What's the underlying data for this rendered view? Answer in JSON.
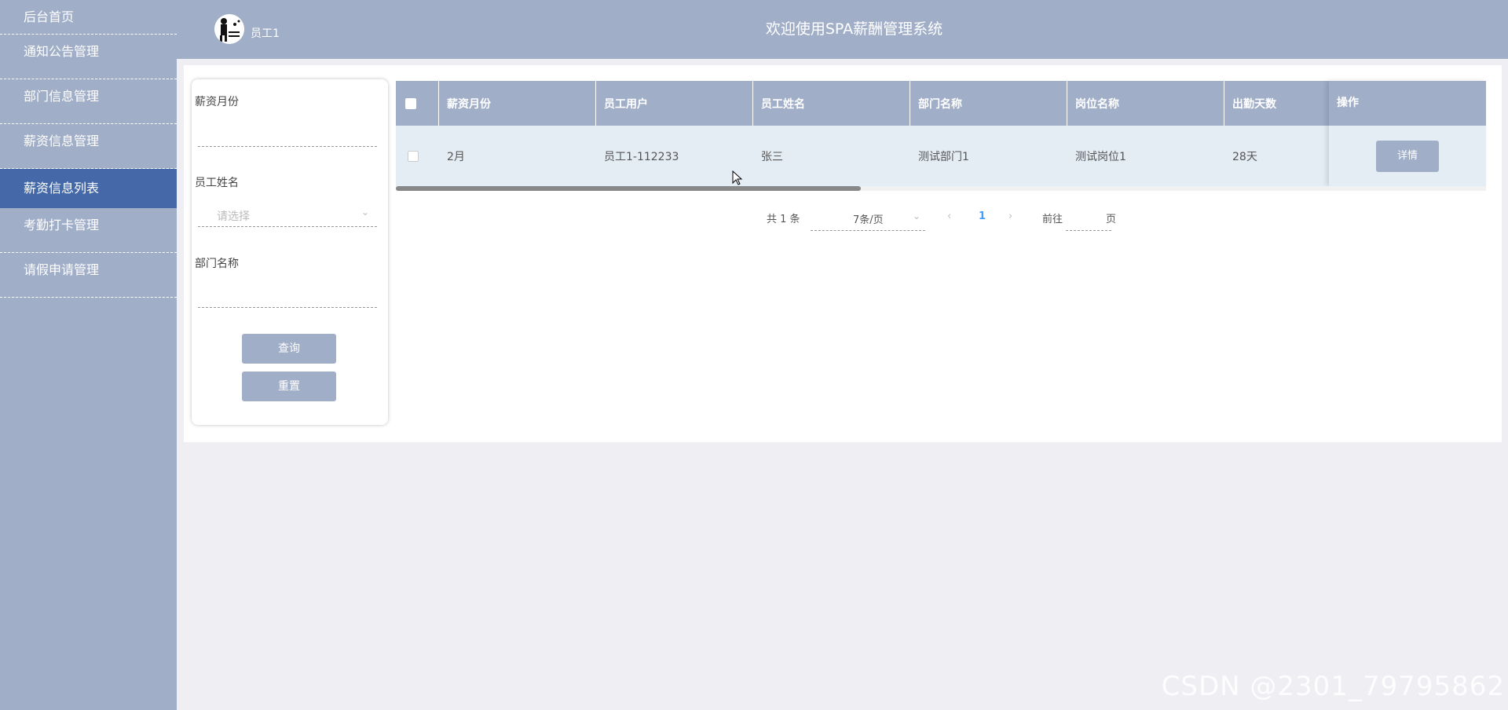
{
  "sidebar": {
    "items": [
      {
        "label": "后台首页"
      },
      {
        "label": "通知公告管理"
      },
      {
        "label": "部门信息管理"
      },
      {
        "label": "薪资信息管理"
      },
      {
        "label": "薪资信息列表"
      },
      {
        "label": "考勤打卡管理"
      },
      {
        "label": "请假申请管理"
      }
    ],
    "active_index": 4
  },
  "header": {
    "user_name": "员工1",
    "title": "欢迎使用SPA薪酬管理系统",
    "avatar_icon": "user-avatar-icon"
  },
  "search": {
    "month_label": "薪资月份",
    "name_label": "员工姓名",
    "name_placeholder": "请选择",
    "dept_label": "部门名称",
    "query_button": "查询",
    "reset_button": "重置"
  },
  "table": {
    "columns": [
      "薪资月份",
      "员工用户",
      "员工姓名",
      "部门名称",
      "岗位名称",
      "出勤天数",
      "操作"
    ],
    "rows": [
      {
        "month": "2月",
        "user": "员工1-112233",
        "name": "张三",
        "dept": "测试部门1",
        "post": "测试岗位1",
        "days": "28天",
        "action": "详情"
      }
    ]
  },
  "pagination": {
    "total_text": "共 1 条",
    "page_size": "7条/页",
    "current_page": "1",
    "goto_prefix": "前往",
    "goto_suffix": "页",
    "prev_icon": "chevron-left-icon",
    "next_icon": "chevron-right-icon"
  },
  "watermark": "CSDN @2301_79795862",
  "colors": {
    "sidebar_bg": "#a0aec8",
    "sidebar_active": "#4468a8",
    "row_bg": "#e4ecf4",
    "page_bg": "#efeff3",
    "accent": "#409eff"
  }
}
